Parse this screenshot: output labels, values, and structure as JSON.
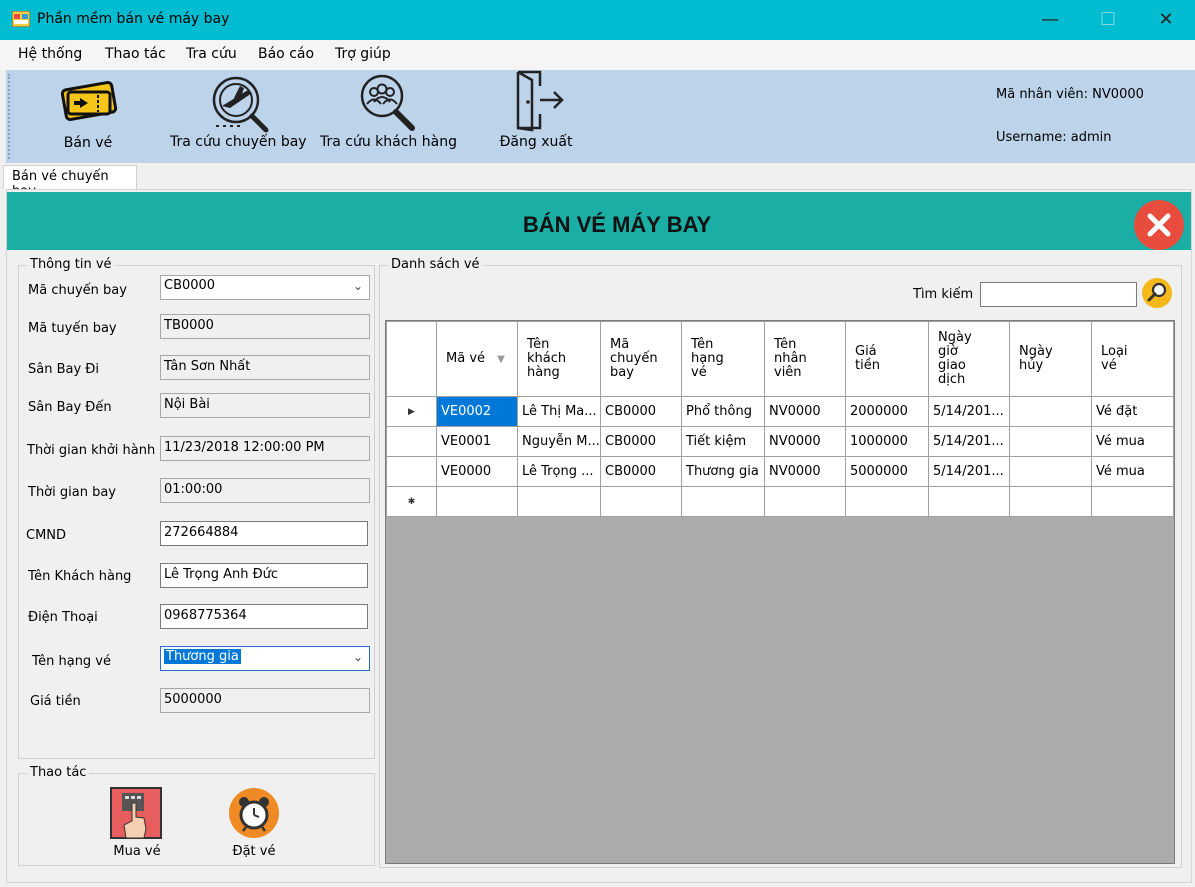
{
  "window": {
    "title": "Phần mềm bán vé máy bay",
    "minimize": "—",
    "maximize": "☐",
    "close": "✕"
  },
  "menu": [
    "Hệ thống",
    "Thao tác",
    "Tra cứu",
    "Báo cáo",
    "Trợ giúp"
  ],
  "toolbar": {
    "sell_ticket": "Bán vé",
    "flight_lookup": "Tra cứu chuyến bay",
    "customer_lookup": "Tra cứu khách hàng",
    "logout": "Đăng xuất",
    "employee_id": "Mã nhân viên: NV0000",
    "username": "Username: admin"
  },
  "tab": {
    "label": "Bán vé chuyến bay"
  },
  "header": {
    "title": "BÁN VÉ MÁY BAY"
  },
  "ticket_info": {
    "title": "Thông tin vé",
    "flight_code_label": "Mã chuyến bay",
    "flight_code": "CB0000",
    "route_code_label": "Mã tuyến bay",
    "route_code": "TB0000",
    "departure_airport_label": "Sân Bay Đi",
    "departure_airport": "Tân Sơn Nhất",
    "arrival_airport_label": "Sân Bay Đến",
    "arrival_airport": "Nội Bài",
    "departure_time_label": "Thời gian khởi hành",
    "departure_time": "11/23/2018 12:00:00 PM",
    "flight_duration_label": "Thời gian bay",
    "flight_duration": "01:00:00",
    "id_card_label": "CMND",
    "id_card": "272664884",
    "customer_name_label": "Tên Khách hàng",
    "customer_name": "Lê Trọng Anh Đức",
    "phone_label": "Điện Thoại",
    "phone": "0968775364",
    "ticket_class_label": "Tên hạng vé",
    "ticket_class": "Thương gia",
    "price_label": "Giá tiền",
    "price": "5000000"
  },
  "actions": {
    "title": "Thao tác",
    "buy": "Mua vé",
    "book": "Đặt vé"
  },
  "ticket_list": {
    "title": "Danh sách vé",
    "search_label": "Tìm kiếm",
    "search_value": "",
    "columns": [
      "Mã vé",
      "Tên khách hàng",
      "Mã chuyến bay",
      "Tên hạng vé",
      "Tên nhân viên",
      "Giá tiền",
      "Ngày giờ giao dịch",
      "Ngày hủy",
      "Loại vé"
    ],
    "rows": [
      [
        "VE0002",
        "Lê Thị Ma...",
        "CB0000",
        "Phổ thông",
        "NV0000",
        "2000000",
        "5/14/201...",
        "",
        "Vé đặt"
      ],
      [
        "VE0001",
        "Nguyễn M...",
        "CB0000",
        "Tiết kiệm",
        "NV0000",
        "1000000",
        "5/14/201...",
        "",
        "Vé mua"
      ],
      [
        "VE0000",
        "Lê Trọng ...",
        "CB0000",
        "Thương gia",
        "NV0000",
        "5000000",
        "5/14/201...",
        "",
        "Vé mua"
      ]
    ],
    "current_row_marker": "▶",
    "new_row_marker": "✱"
  },
  "colors": {
    "titlebar": "#00bcd0",
    "toolbar": "#bcd3ea",
    "header": "#1aaea5",
    "close": "#e84c3d",
    "selection": "#0078d7"
  }
}
